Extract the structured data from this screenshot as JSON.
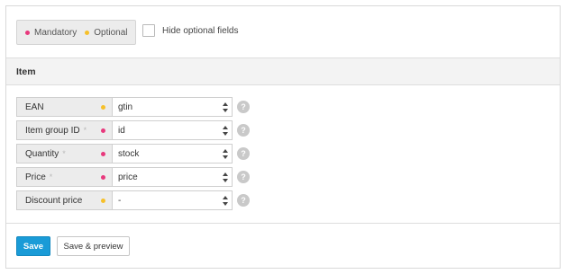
{
  "legend": {
    "mandatory_label": "Mandatory",
    "optional_label": "Optional",
    "mandatory_color": "#e8397d",
    "optional_color": "#f6c02a"
  },
  "hide_optional": {
    "label": "Hide optional fields",
    "checked": false
  },
  "section": {
    "title": "Item"
  },
  "fields": [
    {
      "label": "EAN",
      "required_marker": "",
      "indicator": "optional",
      "value": "gtin"
    },
    {
      "label": "Item group ID",
      "required_marker": "*",
      "indicator": "mandatory",
      "value": "id"
    },
    {
      "label": "Quantity",
      "required_marker": "*",
      "indicator": "mandatory",
      "value": "stock"
    },
    {
      "label": "Price",
      "required_marker": "*",
      "indicator": "mandatory",
      "value": "price"
    },
    {
      "label": "Discount price",
      "required_marker": "",
      "indicator": "optional",
      "value": "-"
    }
  ],
  "help_glyph": "?",
  "actions": {
    "save_label": "Save",
    "save_preview_label": "Save & preview"
  }
}
